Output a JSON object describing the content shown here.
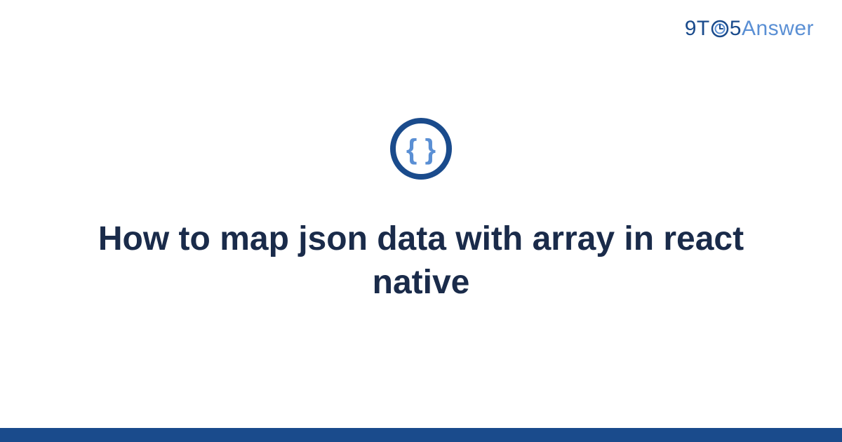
{
  "brand": {
    "prefix": "9T",
    "middle": "5",
    "suffix": "Answer"
  },
  "icon": {
    "name": "code-braces-icon"
  },
  "title": "How to map json data with array in react native",
  "colors": {
    "primary_dark": "#1a4b8c",
    "primary_light": "#5a8fd4",
    "text_dark": "#1a2b4a"
  }
}
